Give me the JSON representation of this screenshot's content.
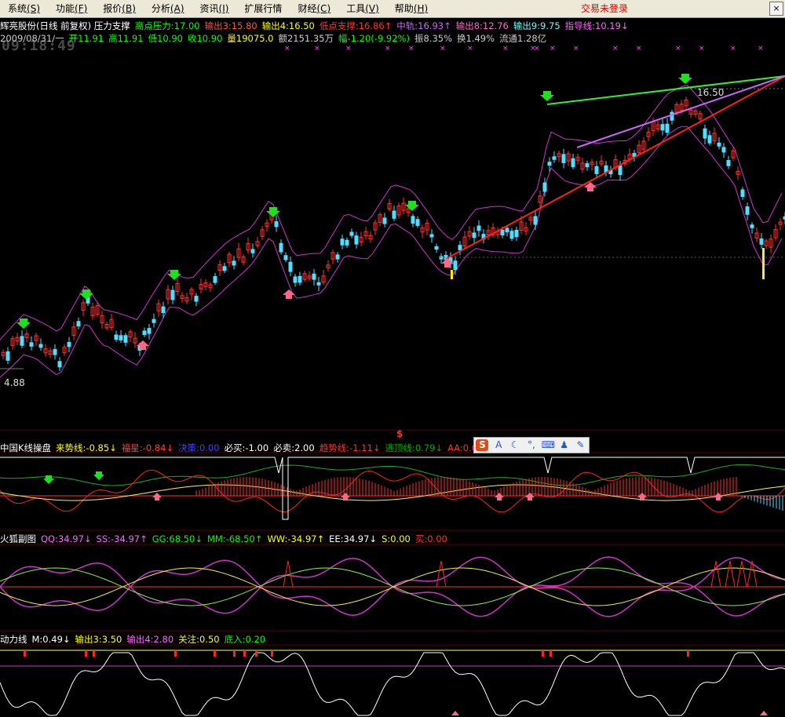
{
  "menu": {
    "items": [
      {
        "id": "system",
        "label": "系统",
        "acc": "(S)"
      },
      {
        "id": "function",
        "label": "功能",
        "acc": "(F)"
      },
      {
        "id": "quote",
        "label": "报价",
        "acc": "(B)"
      },
      {
        "id": "analysis",
        "label": "分析",
        "acc": "(A)"
      },
      {
        "id": "info",
        "label": "资讯",
        "acc": "(I)"
      },
      {
        "id": "ext",
        "label": "扩展行情",
        "acc": ""
      },
      {
        "id": "finance",
        "label": "财经",
        "acc": "(C)"
      },
      {
        "id": "tools",
        "label": "工具",
        "acc": "(V)"
      },
      {
        "id": "help",
        "label": "帮助",
        "acc": "(H)"
      }
    ],
    "status": "交易未登录",
    "close_glyph": "×"
  },
  "clock": "09:18:49",
  "main_header": [
    {
      "text": "辉亮股份(日线 前复权) 压力支撑",
      "color": "#ffffff"
    },
    {
      "text": "高点压力:17.00",
      "color": "#00ff00"
    },
    {
      "text": "输出3:15.80",
      "color": "#ff5050"
    },
    {
      "text": "输出4:16.50",
      "color": "#ffff00"
    },
    {
      "text": "低点支撑:16.86↑",
      "color": "#ff3030"
    },
    {
      "text": "中轨:16.93↑",
      "color": "#cc66ff"
    },
    {
      "text": "输出8:12.76",
      "color": "#ff66cc"
    },
    {
      "text": "输出9:9.75",
      "color": "#66ffff"
    },
    {
      "text": "指导线:10.19↓",
      "color": "#ff66ff"
    }
  ],
  "info_line": [
    {
      "text": "2009/08/31/一",
      "color": "#cccccc"
    },
    {
      "text": "开11.91",
      "color": "#00ff00"
    },
    {
      "text": "高11.91",
      "color": "#00ff00"
    },
    {
      "text": "低10.90",
      "color": "#00ff00"
    },
    {
      "text": "收10.90",
      "color": "#00ff00"
    },
    {
      "text": "量19075.0",
      "color": "#ffff00"
    },
    {
      "text": "额2151.35万",
      "color": "#cccccc"
    },
    {
      "text": "幅-1.20(-9.92%)",
      "color": "#00ff00"
    },
    {
      "text": "振8.35%",
      "color": "#cccccc"
    },
    {
      "text": "换1.49%",
      "color": "#cccccc"
    },
    {
      "text": "流通1.28亿",
      "color": "#cccccc"
    }
  ],
  "price_labels": {
    "high": "16.50",
    "low": "4.88"
  },
  "panel1_header": [
    {
      "text": "中国K线操盘",
      "color": "#ffffff"
    },
    {
      "text": "来势线:-0.85↓",
      "color": "#ffff00"
    },
    {
      "text": "福星:-0.84↓",
      "color": "#ff4040"
    },
    {
      "text": "决策:0.00",
      "color": "#4040ff"
    },
    {
      "text": "必买:-1.00",
      "color": "#ffffff"
    },
    {
      "text": "必卖:2.00",
      "color": "#ffffff"
    },
    {
      "text": "趋势线:-1.11↓",
      "color": "#ff3030"
    },
    {
      "text": "逃顶线:0.79↓",
      "color": "#00aa00"
    },
    {
      "text": "AA:0.00",
      "color": "#ff3030"
    }
  ],
  "panel1_marker": "$",
  "toolbar": {
    "buttons": [
      {
        "id": "ime-logo",
        "glyph": "S"
      },
      {
        "id": "chinese-mode",
        "glyph": "A"
      },
      {
        "id": "moon",
        "glyph": "☾"
      },
      {
        "id": "punct",
        "glyph": "°,"
      },
      {
        "id": "keyboard",
        "glyph": "⌨"
      },
      {
        "id": "user",
        "glyph": "♟"
      },
      {
        "id": "settings",
        "glyph": "✎"
      }
    ]
  },
  "panel2_header": [
    {
      "text": "火狐副图",
      "color": "#ffffff"
    },
    {
      "text": "QQ:34.97↓",
      "color": "#ff66ff"
    },
    {
      "text": "SS:-34.97↑",
      "color": "#ff66ff"
    },
    {
      "text": "GG:68.50↓",
      "color": "#00ff00"
    },
    {
      "text": "MM:-68.50↑",
      "color": "#00ff00"
    },
    {
      "text": "WW:-34.97↑",
      "color": "#ffff00"
    },
    {
      "text": "EE:34.97↓",
      "color": "#ffffff"
    },
    {
      "text": "S:0.00",
      "color": "#ffff00"
    },
    {
      "text": "买:0.00",
      "color": "#ff3030"
    }
  ],
  "panel3_header": [
    {
      "text": "动力线",
      "color": "#ffffff"
    },
    {
      "text": "M:0.49↓",
      "color": "#ffffff"
    },
    {
      "text": "输出3:3.50",
      "color": "#ffff00"
    },
    {
      "text": "输出4:2.80",
      "color": "#ff66ff"
    },
    {
      "text": "关注:0.50",
      "color": "#ffff00"
    },
    {
      "text": "底入:0.20",
      "color": "#00ff00"
    }
  ],
  "colors": {
    "up": "#ff3030",
    "down": "#55ddff",
    "bg": "#000000",
    "border": "#8b0000"
  }
}
